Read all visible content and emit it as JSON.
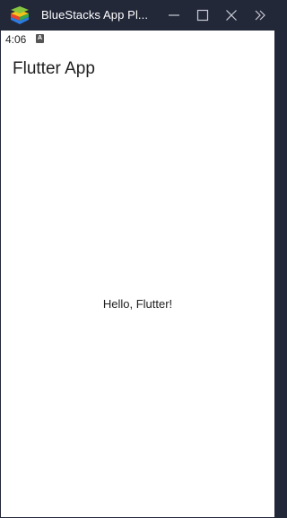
{
  "window": {
    "title": "BlueStacks App Pl...",
    "logo_icon": "bluestacks-logo-icon",
    "controls": {
      "minimize_icon": "minimize-icon",
      "maximize_icon": "maximize-icon",
      "close_icon": "close-icon",
      "expand_icon": "double-chevron-right-icon"
    }
  },
  "statusbar": {
    "time": "4:06",
    "notification_icon": "a-letter-icon",
    "notification_letter": "A"
  },
  "appbar": {
    "title": "Flutter App"
  },
  "main": {
    "text": "Hello, Flutter!"
  },
  "colors": {
    "titlebar_bg": "#232839",
    "screen_bg": "#ffffff",
    "text": "#1f1f1f"
  }
}
